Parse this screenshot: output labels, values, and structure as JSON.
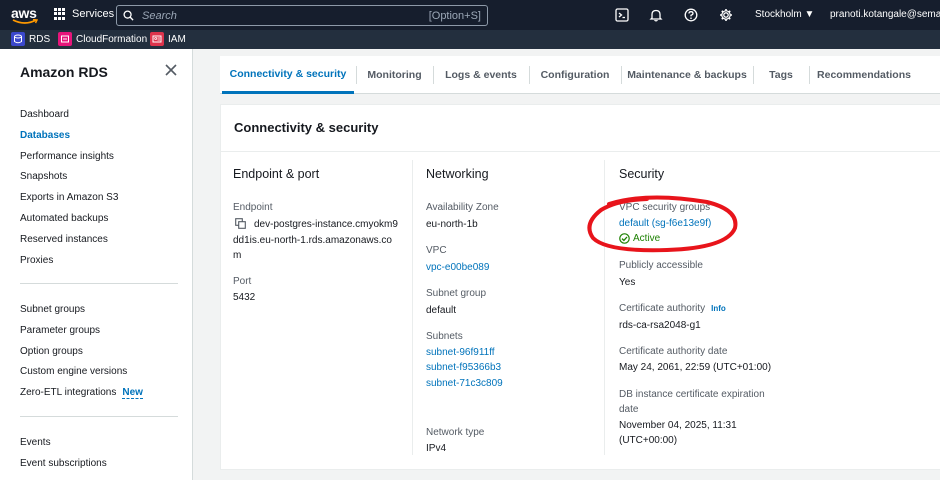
{
  "topbar": {
    "logo_text": "aws",
    "services_label": "Services",
    "search_placeholder": "Search",
    "search_shortcut": "[Option+S]",
    "icons": [
      "cloudshell-icon",
      "bell-icon",
      "help-icon",
      "gear-icon"
    ],
    "region": "Stockholm ▼",
    "account": "pranoti.kotangale@semarchy"
  },
  "favorites": [
    {
      "label": "RDS",
      "icon": "rds-icon",
      "color": "#3b48cc"
    },
    {
      "label": "CloudFormation",
      "icon": "cloudformation-icon",
      "color": "#e7157b"
    },
    {
      "label": "IAM",
      "icon": "iam-icon",
      "color": "#dd344c"
    }
  ],
  "sidebar": {
    "title": "Amazon RDS",
    "items": [
      {
        "label": "Dashboard"
      },
      {
        "label": "Databases",
        "active": true
      },
      {
        "label": "Performance insights"
      },
      {
        "label": "Snapshots"
      },
      {
        "label": "Exports in Amazon S3"
      },
      {
        "label": "Automated backups"
      },
      {
        "label": "Reserved instances"
      },
      {
        "label": "Proxies"
      },
      {
        "label": "Subnet groups"
      },
      {
        "label": "Parameter groups"
      },
      {
        "label": "Option groups"
      },
      {
        "label": "Custom engine versions"
      },
      {
        "label": "Zero-ETL integrations",
        "badge": "New"
      },
      {
        "label": "Events"
      },
      {
        "label": "Event subscriptions"
      }
    ]
  },
  "tabs": [
    {
      "label": "Connectivity & security",
      "active": true
    },
    {
      "label": "Monitoring"
    },
    {
      "label": "Logs & events"
    },
    {
      "label": "Configuration"
    },
    {
      "label": "Maintenance & backups"
    },
    {
      "label": "Tags"
    },
    {
      "label": "Recommendations"
    }
  ],
  "panel": {
    "title": "Connectivity & security",
    "endpoint_port": {
      "heading": "Endpoint & port",
      "endpoint_label": "Endpoint",
      "endpoint_lines": [
        "dev-postgres-instance.cmyokm9",
        "dd1is.eu-north-1.rds.amazonaws.co",
        "m"
      ],
      "port_label": "Port",
      "port_value": "5432"
    },
    "networking": {
      "heading": "Networking",
      "az_label": "Availability Zone",
      "az_value": "eu-north-1b",
      "vpc_label": "VPC",
      "vpc_value": "vpc-e00be089",
      "subnet_group_label": "Subnet group",
      "subnet_group_value": "default",
      "subnets_label": "Subnets",
      "subnets": [
        "subnet-96f911ff",
        "subnet-f95366b3",
        "subnet-71c3c809"
      ],
      "network_type_label": "Network type",
      "network_type_value": "IPv4"
    },
    "security": {
      "heading": "Security",
      "sg_label": "VPC security groups",
      "sg_value": "default (sg-f6e13e9f)",
      "sg_status": "Active",
      "public_label": "Publicly accessible",
      "public_value": "Yes",
      "ca_label": "Certificate authority",
      "ca_info": "Info",
      "ca_value": "rds-ca-rsa2048-g1",
      "ca_date_label": "Certificate authority date",
      "ca_date_value": "May 24, 2061, 22:59 (UTC+01:00)",
      "expiry_label_lines": [
        "DB instance certificate expiration",
        "date"
      ],
      "expiry_value_lines": [
        "November 04, 2025, 11:31",
        "(UTC+00:00)"
      ]
    }
  },
  "colors": {
    "accent": "#0073bb",
    "annotation": "#e8141b",
    "active_status": "#1d8102"
  }
}
